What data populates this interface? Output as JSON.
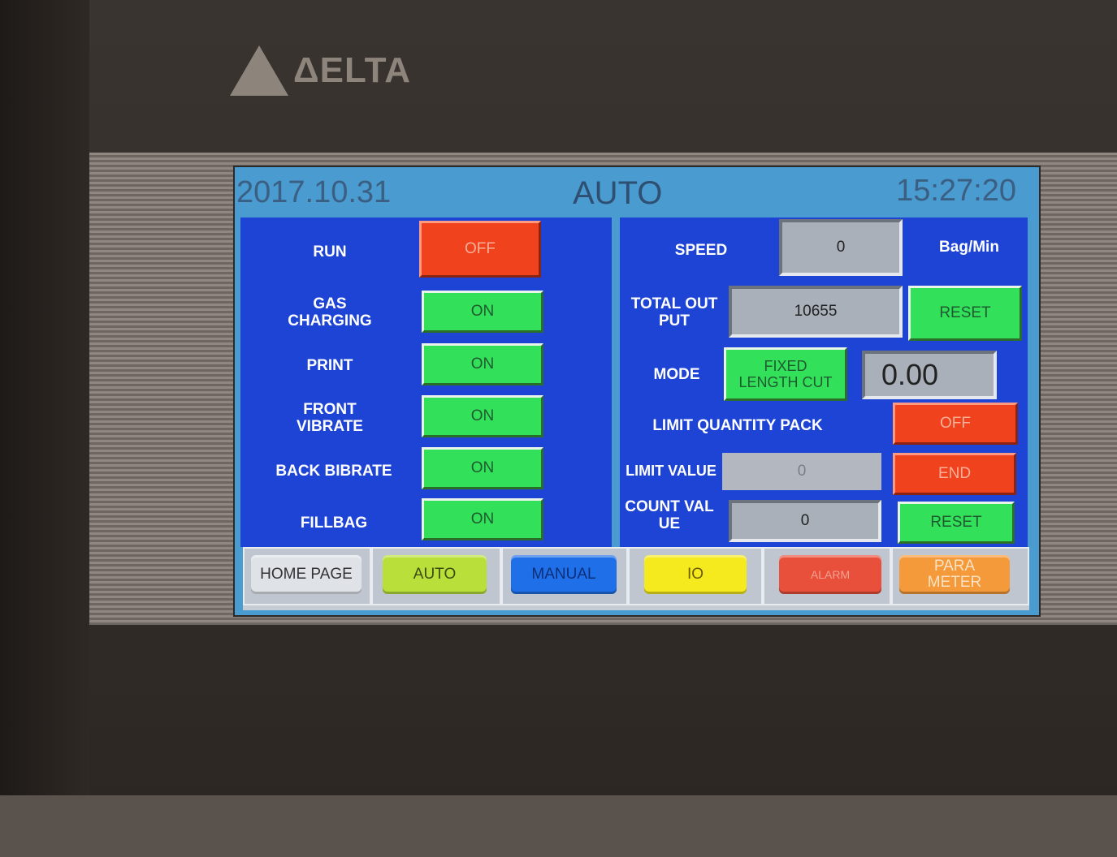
{
  "brand": {
    "name": "ΔELTA"
  },
  "header": {
    "date": "2017.10.31",
    "mode": "AUTO",
    "time": "15:27:20"
  },
  "left_panel": {
    "rows": [
      {
        "label": "RUN",
        "state": "OFF"
      },
      {
        "label": "GAS\nCHARGING",
        "state": "ON"
      },
      {
        "label": "PRINT",
        "state": "ON"
      },
      {
        "label": "FRONT\nVIBRATE",
        "state": "ON"
      },
      {
        "label": "BACK BIBRATE",
        "state": "ON"
      },
      {
        "label": "FILLBAG",
        "state": "ON"
      }
    ]
  },
  "right_panel": {
    "speed": {
      "label": "SPEED",
      "value": "0",
      "unit": "Bag/Min"
    },
    "total_output": {
      "label": "TOTAL OUT\nPUT",
      "value": "10655",
      "reset_label": "RESET"
    },
    "mode": {
      "label": "MODE",
      "button_label": "FIXED\nLENGTH CUT",
      "value": "0.00"
    },
    "limit_quantity_pack": {
      "label": "LIMIT QUANTITY PACK",
      "state": "OFF"
    },
    "limit_value": {
      "label": "LIMIT VALUE",
      "value": "0",
      "end_label": "END"
    },
    "count_value": {
      "label": "COUNT VAL\nUE",
      "value": "0",
      "reset_label": "RESET"
    }
  },
  "nav": {
    "items": [
      {
        "label": "HOME PAGE",
        "color": "#dfe3e8",
        "text": "#333333"
      },
      {
        "label": "AUTO",
        "color": "#b9e03a",
        "text": "#3d4a10"
      },
      {
        "label": "MANUAL",
        "color": "#1f6fe8",
        "text": "#0d2f7a"
      },
      {
        "label": "IO",
        "color": "#f5ea1e",
        "text": "#6a5a00"
      },
      {
        "label": "ALARM",
        "color": "#e8503c",
        "text": "#f6a090"
      },
      {
        "label": "PARA\nMETER",
        "color": "#f49a3a",
        "text": "#fbe2c4"
      }
    ]
  }
}
